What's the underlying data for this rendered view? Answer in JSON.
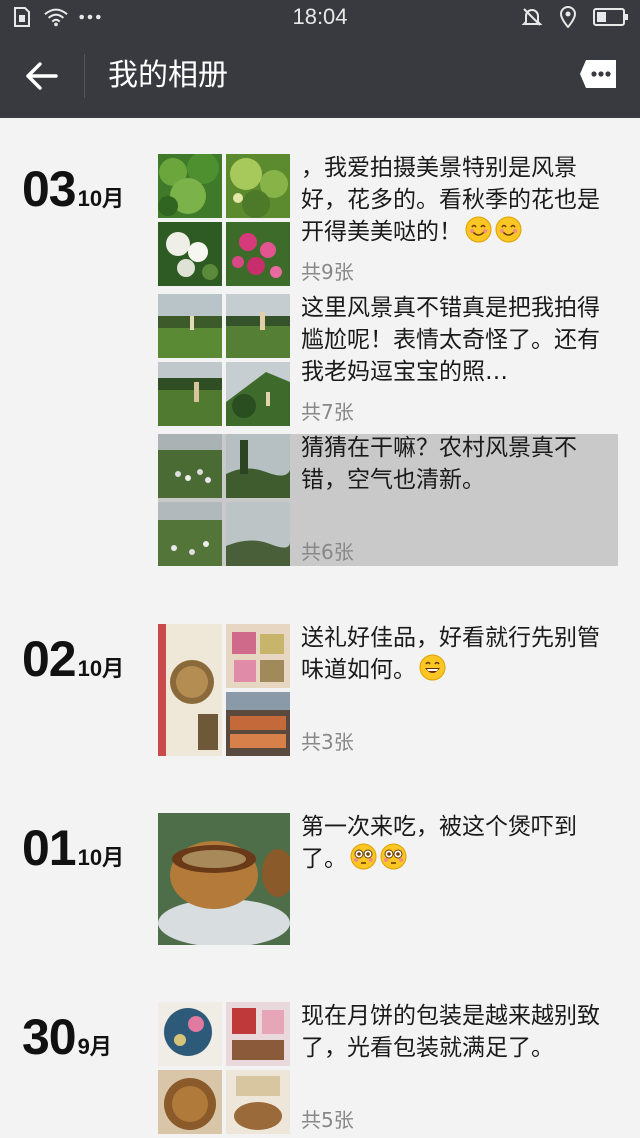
{
  "status_bar": {
    "time": "18:04",
    "left_icons": [
      "sim-icon",
      "wifi-icon",
      "more-dots-icon"
    ],
    "right_icons": [
      "mute-bell-icon",
      "location-icon",
      "battery-icon"
    ]
  },
  "header": {
    "title": "我的相册",
    "back_icon": "back-arrow-icon",
    "more_icon": "more-icon",
    "background": "#393a3f"
  },
  "entries": [
    {
      "day": "03",
      "month": "10月",
      "posts": [
        {
          "text": "，我爱拍摄美景特别是风景好，花多的。看秋季的花也是开得美美哒的！",
          "emojis": [
            "smile-blush",
            "smile-blush"
          ],
          "count": "共9张",
          "photos": 4
        },
        {
          "text": "这里风景真不错真是把我拍得尴尬呢！表情太奇怪了。还有我老妈逗宝宝的照…",
          "emojis": [],
          "count": "共7张",
          "photos": 4
        },
        {
          "text": "猜猜在干嘛？农村风景真不错，空气也清新。",
          "emojis": [],
          "count": "共6张",
          "photos": 4,
          "selected": true
        }
      ]
    },
    {
      "day": "02",
      "month": "10月",
      "posts": [
        {
          "text": "送礼好佳品，好看就行先别管味道如何。",
          "emojis": [
            "grin"
          ],
          "count": "共3张",
          "photos": 3
        }
      ]
    },
    {
      "day": "01",
      "month": "10月",
      "posts": [
        {
          "text": "第一次来吃，被这个煲吓到了。",
          "emojis": [
            "flushed",
            "flushed"
          ],
          "count": "",
          "photos": 1
        }
      ]
    },
    {
      "day": "30",
      "month": "9月",
      "posts": [
        {
          "text": "现在月饼的包装是越来越别致了，光看包装就满足了。",
          "emojis": [],
          "count": "共5张",
          "photos": 4
        }
      ]
    }
  ],
  "colors": {
    "background": "#f3f3f3",
    "selected_row": "#c9c9c9",
    "count_text": "#888888"
  }
}
